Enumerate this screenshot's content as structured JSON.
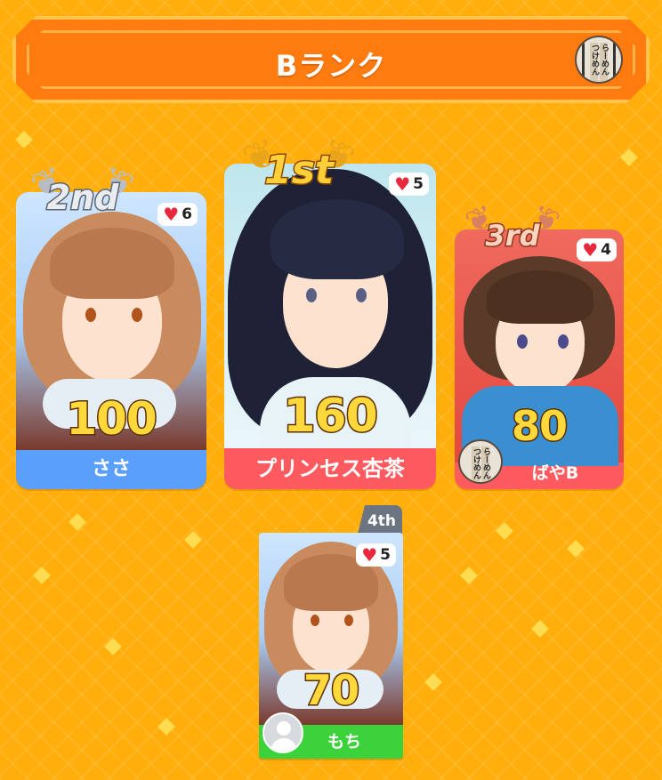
{
  "header": {
    "title": "Bランク",
    "avatar_icon": "ramen-avatar-icon",
    "avatar_text": [
      "らーめん",
      "つけめん"
    ]
  },
  "colors": {
    "background": "#ffae0b",
    "header": "#ff7b0f",
    "blue_card": "#5a9ffb",
    "red_card": "#ff5a5f",
    "green_card": "#3bd23b",
    "gold": "#ffd93b"
  },
  "rankings": [
    {
      "rank_label": "1st",
      "name": "プリンセス杏茶",
      "score": "160",
      "likes": "5",
      "card_color": "#ff5a5f"
    },
    {
      "rank_label": "2nd",
      "name": "ささ",
      "score": "100",
      "likes": "6",
      "card_color": "#5a9ffb"
    },
    {
      "rank_label": "3rd",
      "name": "ばやB",
      "score": "80",
      "likes": "4",
      "card_color": "#ff5a5f"
    },
    {
      "rank_label": "4th",
      "name": "もち",
      "score": "70",
      "likes": "5",
      "card_color": "#3bd23b"
    }
  ]
}
